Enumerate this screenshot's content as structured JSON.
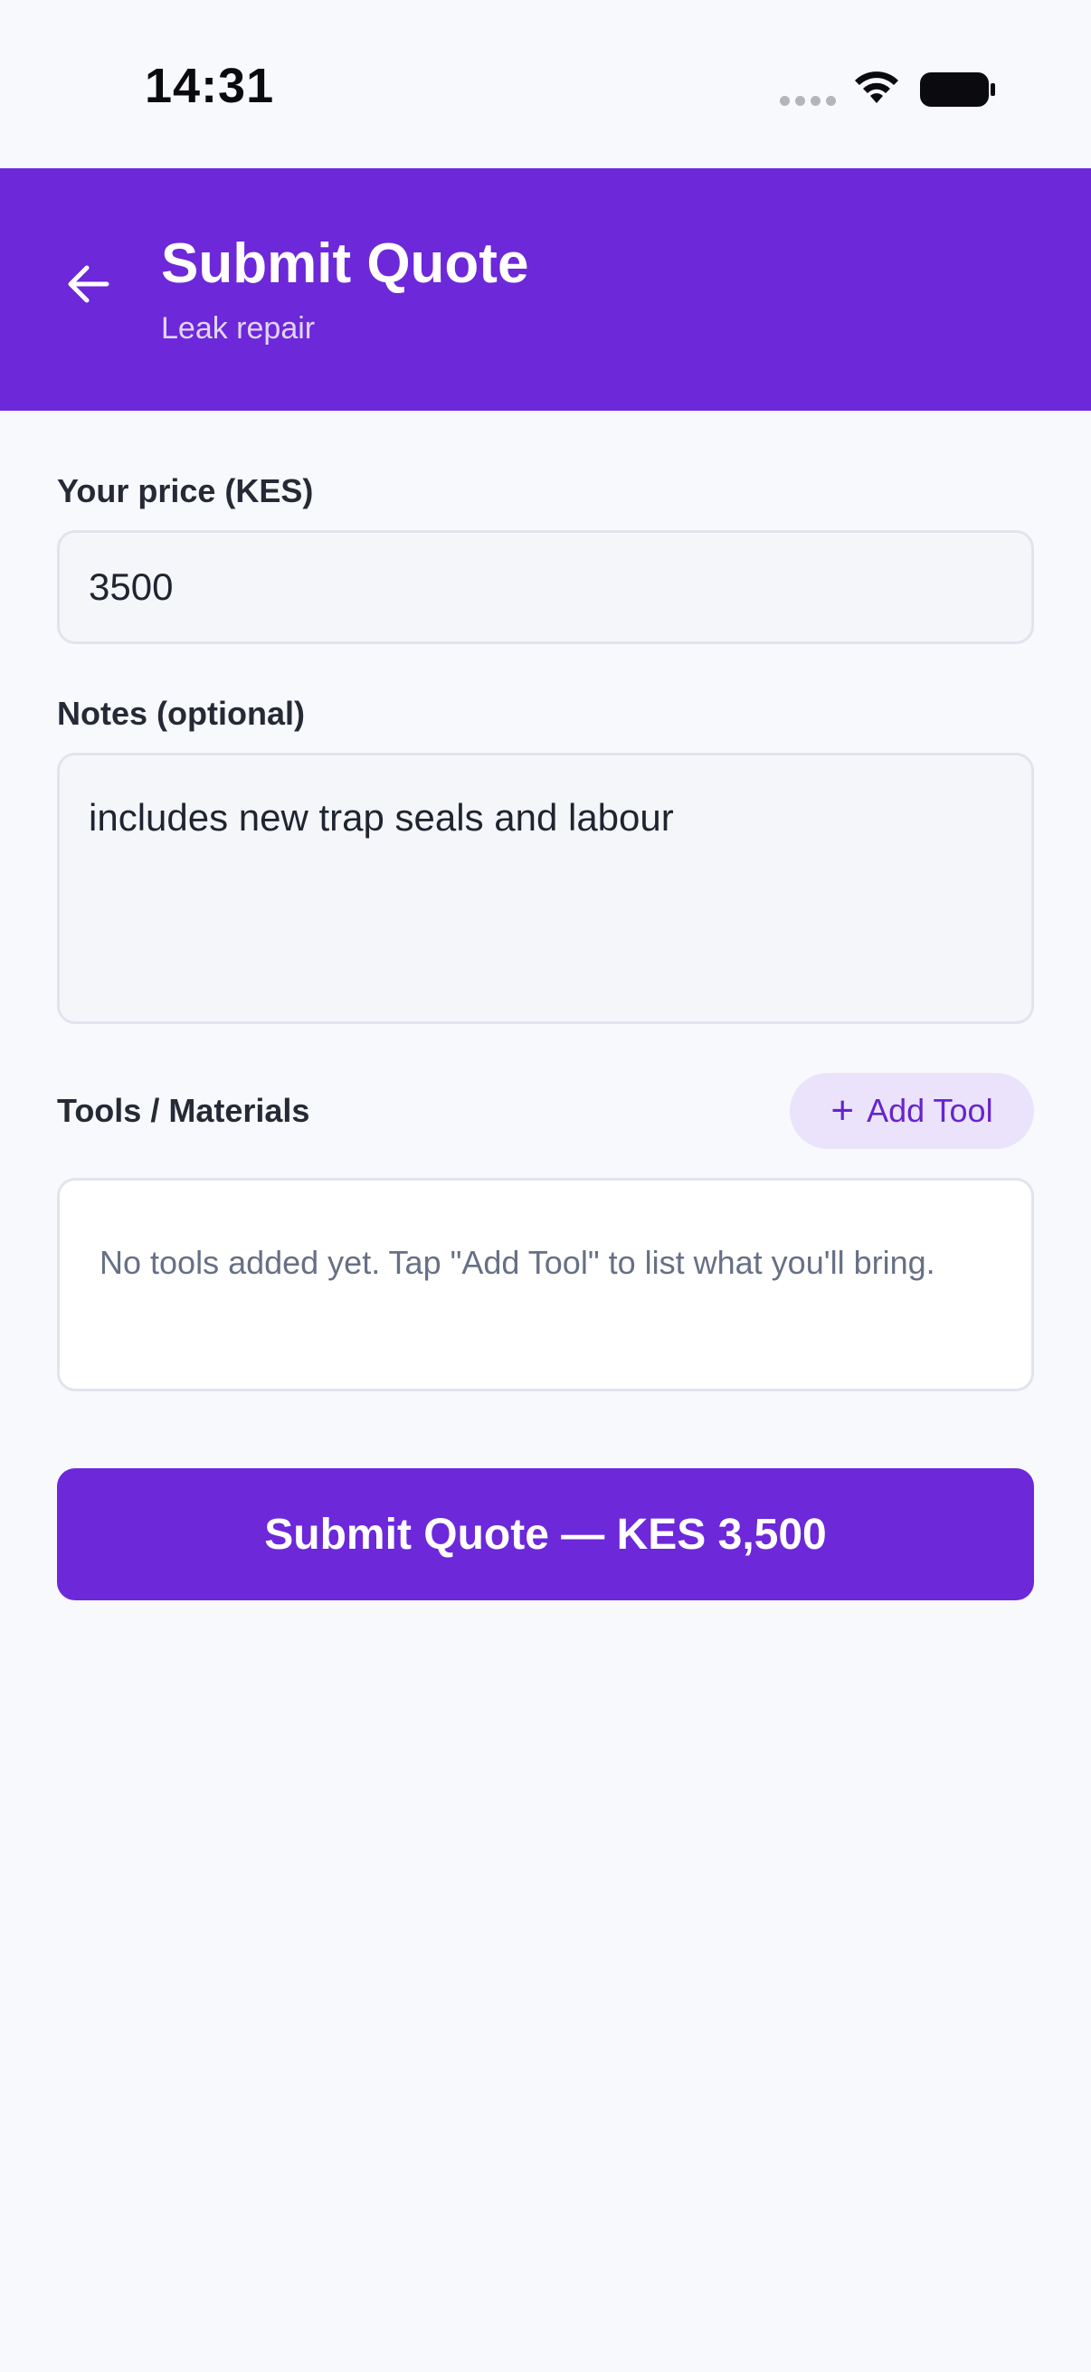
{
  "status_bar": {
    "time": "14:31",
    "icons": [
      "signal-dots-icon",
      "wifi-icon",
      "battery-icon"
    ]
  },
  "header": {
    "title": "Submit Quote",
    "subtitle": "Leak repair",
    "back_icon": "arrow-left-icon",
    "background_color": "#6c28d9"
  },
  "form": {
    "price": {
      "label": "Your price (KES)",
      "value": "3500"
    },
    "notes": {
      "label": "Notes (optional)",
      "value": "includes new trap seals and labour"
    },
    "tools": {
      "label": "Tools / Materials",
      "add_button_label": "Add Tool",
      "add_icon": "plus-icon",
      "empty_text": "No tools added yet. Tap \"Add Tool\" to list what you'll bring."
    }
  },
  "submit": {
    "label": "Submit Quote — KES 3,500"
  },
  "colors": {
    "accent": "#6c28d9",
    "accent_light": "#ebe3fb",
    "background": "#f8f9fc"
  }
}
